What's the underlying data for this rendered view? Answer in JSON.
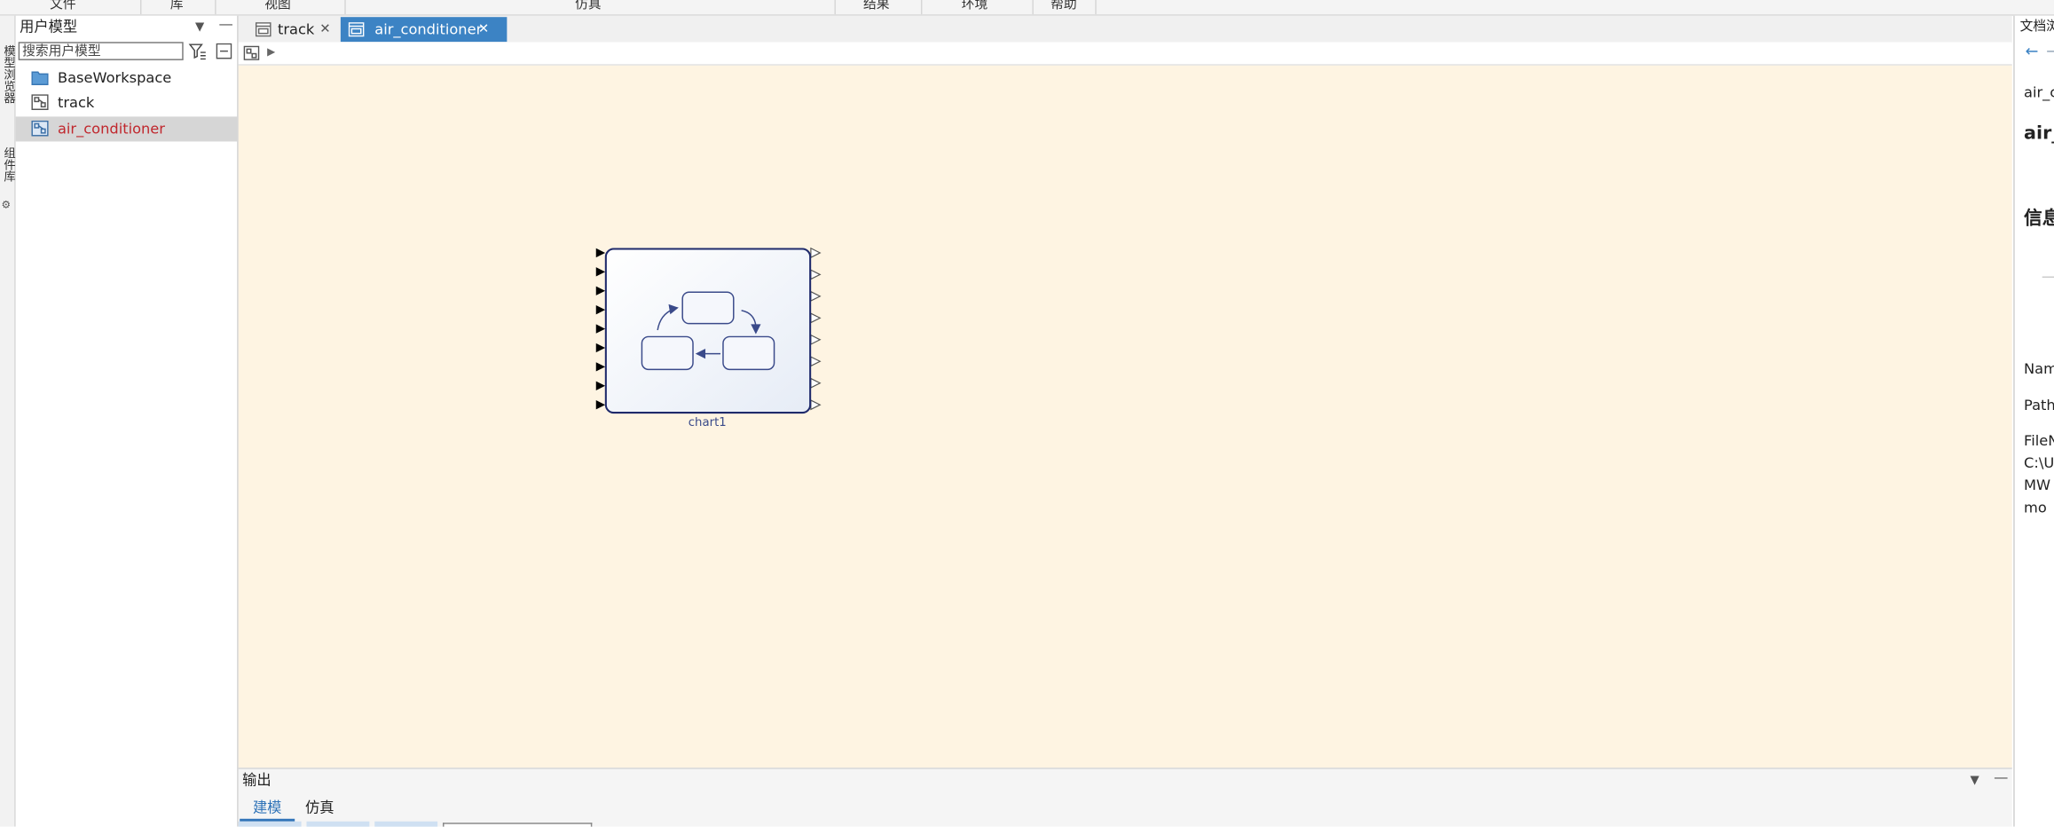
{
  "menu": [
    "文件",
    "库",
    "视图",
    "仿真",
    "结果",
    "环境",
    "帮助"
  ],
  "left_strip": {
    "tab1": "模型浏览器",
    "tab2": "组件库"
  },
  "left_panel": {
    "title": "用户模型",
    "search_placeholder": "搜索用户模型",
    "items": [
      {
        "label": "BaseWorkspace",
        "icon": "folder-icon"
      },
      {
        "label": "track",
        "icon": "model-icon"
      },
      {
        "label": "air_conditioner",
        "icon": "model-icon",
        "selected": true
      }
    ]
  },
  "tabs": [
    {
      "label": "track",
      "active": false
    },
    {
      "label": "air_conditioner",
      "active": true
    }
  ],
  "canvas": {
    "block_label": "chart1",
    "input_ports": 9,
    "output_ports": 8
  },
  "output": {
    "title": "输出",
    "tabs": [
      "建模",
      "仿真"
    ]
  },
  "right_panel": {
    "title": "文档浏",
    "line1": "air_c",
    "heading": "air_",
    "section": "信息",
    "name_label": "Nam",
    "path_label": "Path",
    "file_label": "FileN",
    "file_line1": "C:\\U",
    "file_line2": "MW",
    "file_line3": "mo"
  },
  "colors": {
    "canvas_bg": "#fef4e2",
    "tab_active": "#3c83c4",
    "selected_text": "#c0272d",
    "block_stroke": "#1f2a6b"
  }
}
